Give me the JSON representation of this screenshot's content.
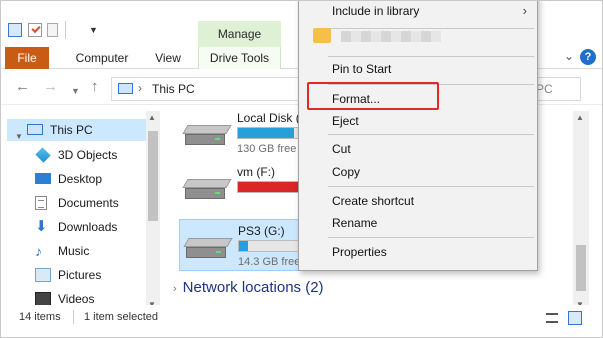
{
  "ribbon": {
    "manage_label": "Manage",
    "tabs": [
      "File",
      "Computer",
      "View",
      "Drive Tools"
    ],
    "help_label": "?",
    "colors": {
      "file_tab": "#c85c14",
      "manage_tab": "#dff1d4"
    }
  },
  "address": {
    "location": "This PC",
    "search_placeholder": "PC"
  },
  "navpane": {
    "items": [
      {
        "label": "This PC",
        "icon": "computer-icon",
        "selected": true
      },
      {
        "label": "3D Objects",
        "icon": "cube-icon"
      },
      {
        "label": "Desktop",
        "icon": "desktop-icon"
      },
      {
        "label": "Documents",
        "icon": "document-icon"
      },
      {
        "label": "Downloads",
        "icon": "download-arrow-icon"
      },
      {
        "label": "Music",
        "icon": "music-note-icon"
      },
      {
        "label": "Pictures",
        "icon": "picture-icon"
      },
      {
        "label": "Videos",
        "icon": "video-icon"
      }
    ]
  },
  "drives": [
    {
      "name": "Local Disk (",
      "free": "130 GB free",
      "used_fraction": 0.3,
      "bar_color": "#26a0da"
    },
    {
      "name": "vm (F:)",
      "free": "",
      "used_fraction": 0.95,
      "bar_color": "#da2626"
    },
    {
      "name": "PS3 (G:)",
      "free": "14.3 GB free",
      "used_fraction": 0.05,
      "bar_color": "#26a0da",
      "selected": true
    }
  ],
  "group": {
    "label": "Network locations (2)"
  },
  "status": {
    "item_count": "14 items",
    "selection": "1 item selected"
  },
  "context_menu": {
    "items": [
      {
        "label": "Include in library",
        "submenu": true
      },
      {
        "label": "Pin to Start"
      },
      {
        "label": "Format...",
        "highlighted": true
      },
      {
        "label": "Eject"
      },
      {
        "label": "Cut"
      },
      {
        "label": "Copy"
      },
      {
        "label": "Create shortcut"
      },
      {
        "label": "Rename"
      },
      {
        "label": "Properties"
      }
    ],
    "highlight_color": "#e02a2a"
  }
}
